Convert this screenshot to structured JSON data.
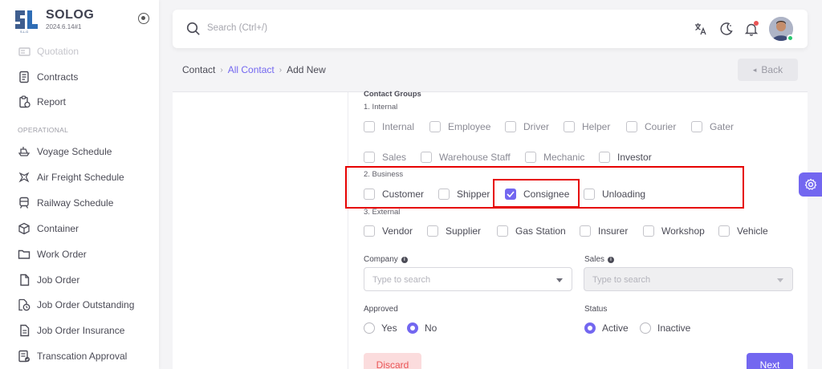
{
  "brand": {
    "name": "SOLOG",
    "version": "2024.6.14#1"
  },
  "sidebar": {
    "items_top": [
      {
        "label": "Quotation",
        "icon": "quotation-icon"
      },
      {
        "label": "Contracts",
        "icon": "contracts-icon"
      },
      {
        "label": "Report",
        "icon": "report-icon"
      }
    ],
    "section_label": "OPERATIONAL",
    "items": [
      {
        "label": "Voyage Schedule",
        "icon": "ship-icon"
      },
      {
        "label": "Air Freight Schedule",
        "icon": "airplane-icon"
      },
      {
        "label": "Railway Schedule",
        "icon": "train-icon"
      },
      {
        "label": "Container",
        "icon": "box-icon"
      },
      {
        "label": "Work Order",
        "icon": "folder-icon"
      },
      {
        "label": "Job Order",
        "icon": "file-icon"
      },
      {
        "label": "Job Order Outstanding",
        "icon": "file-clock-icon"
      },
      {
        "label": "Job Order Insurance",
        "icon": "file-text-icon"
      },
      {
        "label": "Transcation Approval",
        "icon": "checklist-icon"
      }
    ]
  },
  "header": {
    "search_placeholder": "Search (Ctrl+/)"
  },
  "breadcrumb": {
    "root": "Contact",
    "parent": "All Contact",
    "current": "Add New"
  },
  "back_label": "Back",
  "form": {
    "groups_title": "Contact Groups",
    "internal_label": "1. Internal",
    "internal": [
      "Internal",
      "Employee",
      "Driver",
      "Helper",
      "Courier",
      "Gater",
      "Sales",
      "Warehouse Staff",
      "Mechanic",
      "Investor"
    ],
    "business_label": "2. Business",
    "business": [
      "Customer",
      "Shipper",
      "Consignee",
      "Unloading"
    ],
    "business_checked": "Consignee",
    "external_label": "3. External",
    "external": [
      "Vendor",
      "Supplier",
      "Gas Station",
      "Insurer",
      "Workshop",
      "Vehicle"
    ],
    "company_label": "Company",
    "company_placeholder": "Type to search",
    "sales_label": "Sales",
    "sales_placeholder": "Type to search",
    "approved_label": "Approved",
    "approved_options": [
      "Yes",
      "No"
    ],
    "approved_selected": "No",
    "status_label": "Status",
    "status_options": [
      "Active",
      "Inactive"
    ],
    "status_selected": "Active",
    "discard_label": "Discard",
    "next_label": "Next"
  },
  "colors": {
    "accent": "#7367f0",
    "danger": "#ea5455",
    "highlight": "#e60000"
  }
}
